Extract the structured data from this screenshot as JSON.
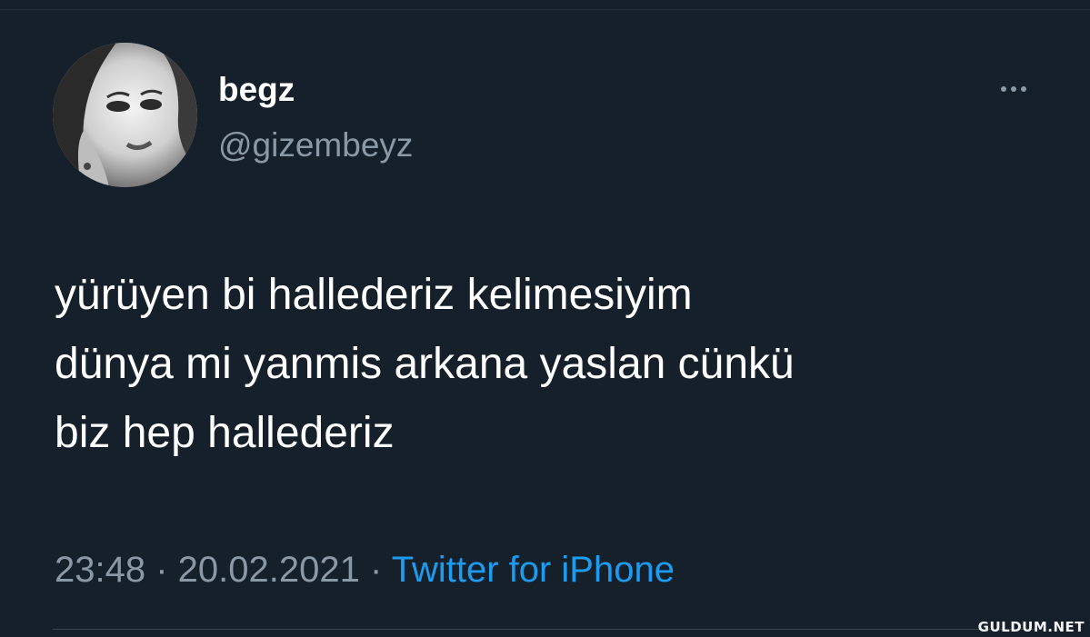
{
  "tweet": {
    "display_name": "begz",
    "handle": "@gizembeyz",
    "text_lines": [
      "yürüyen bi hallederiz kelimesiyim",
      "dünya mi yanmis arkana yaslan cünkü",
      "biz hep hallederiz"
    ],
    "time": "23:48",
    "date": "20.02.2021",
    "separator": "·",
    "source": "Twitter for iPhone",
    "avatar_icon": "profile-photo",
    "more_icon": "more-dots-icon"
  },
  "watermark": "GULDUM.NET",
  "colors": {
    "background": "#15202b",
    "text_primary": "#ffffff",
    "text_secondary": "#8b98a5",
    "link": "#1d9bf0",
    "divider": "#38444d"
  }
}
